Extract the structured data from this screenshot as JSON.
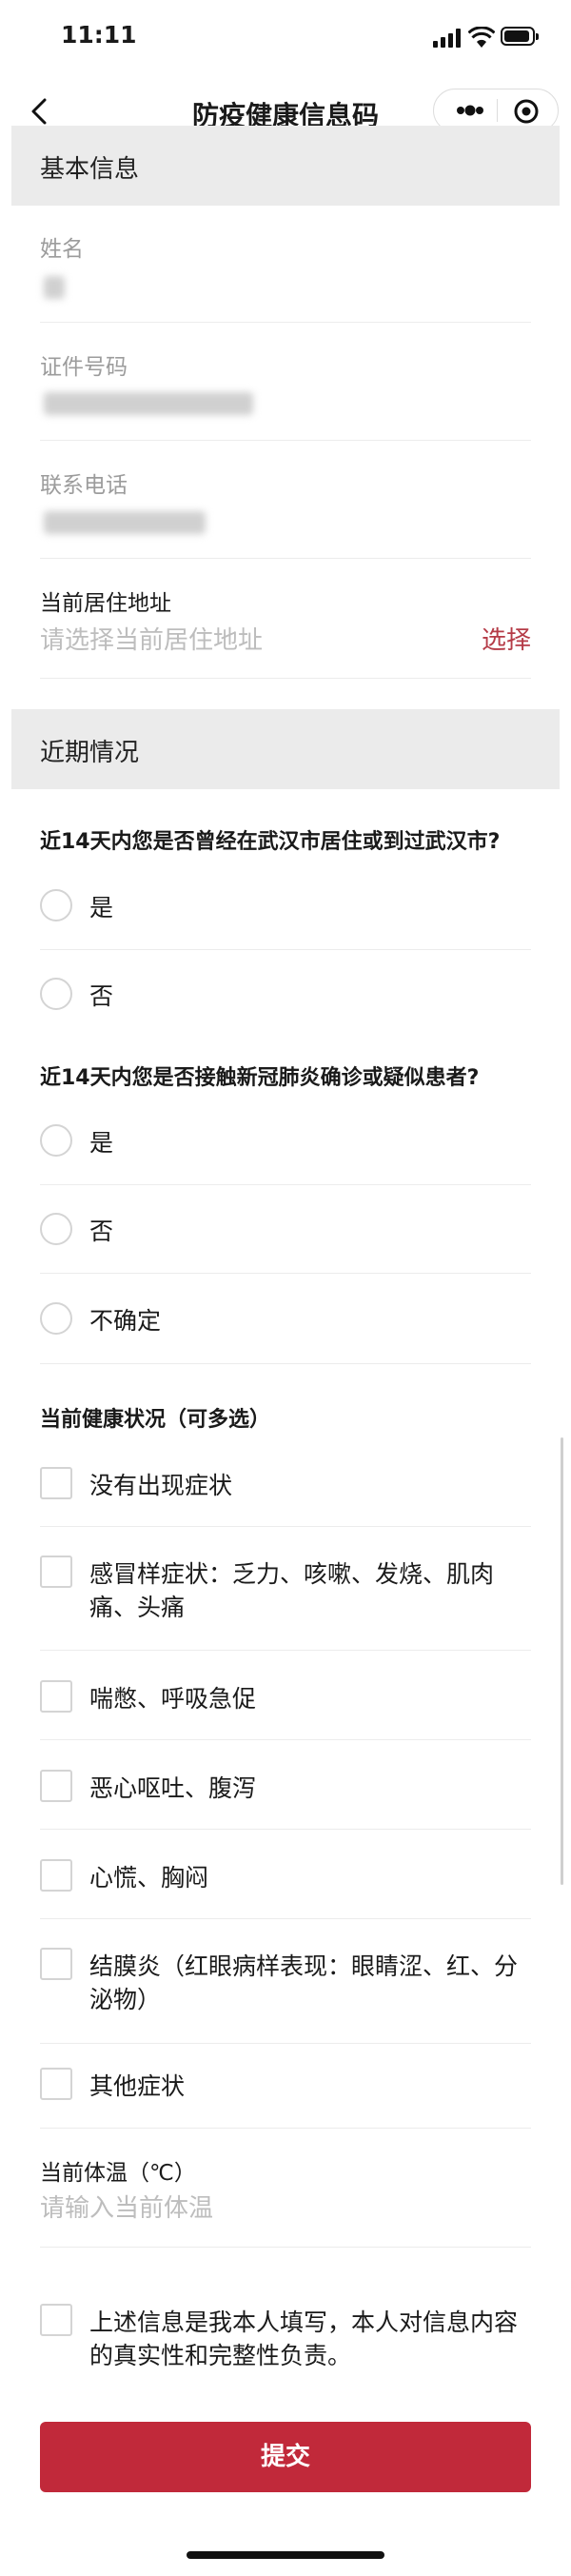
{
  "status_bar": {
    "time": "11:11"
  },
  "nav": {
    "title": "防疫健康信息码"
  },
  "basic_info": {
    "section_title": "基本信息",
    "name_label": "姓名",
    "id_label": "证件号码",
    "phone_label": "联系电话",
    "address_label": "当前居住地址",
    "address_placeholder": "请选择当前居住地址",
    "select_label": "选择"
  },
  "recent": {
    "section_title": "近期情况",
    "q1": {
      "text": "近14天内您是否曾经在武汉市居住或到过武汉市?",
      "options": [
        "是",
        "否"
      ]
    },
    "q2": {
      "text": "近14天内您是否接触新冠肺炎确诊或疑似患者?",
      "options": [
        "是",
        "否",
        "不确定"
      ]
    },
    "q3": {
      "text": "当前健康状况（可多选）",
      "options": [
        "没有出现症状",
        "感冒样症状：乏力、咳嗽、发烧、肌肉痛、头痛",
        "喘憋、呼吸急促",
        "恶心呕吐、腹泻",
        "心慌、胸闷",
        "结膜炎（红眼病样表现：眼睛涩、红、分泌物）",
        "其他症状"
      ]
    },
    "temperature_label": "当前体温（℃）",
    "temperature_placeholder": "请输入当前体温",
    "declaration": "上述信息是我本人填写，本人对信息内容的真实性和完整性负责。"
  },
  "submit_label": "提交",
  "colors": {
    "accent": "#c1293a",
    "link": "#b53b47",
    "section_bg": "#ebebeb"
  }
}
